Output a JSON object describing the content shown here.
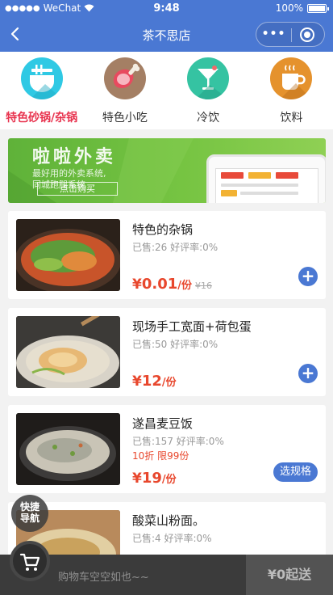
{
  "status_bar": {
    "carrier": "WeChat",
    "time": "9:48",
    "battery": "100%"
  },
  "nav": {
    "title": "茶不思店",
    "more_label": "•••"
  },
  "categories": [
    {
      "label": "特色砂锅/杂锅",
      "icon": "noodle-bowl-icon",
      "active": true
    },
    {
      "label": "特色小吃",
      "icon": "ham-leg-icon",
      "active": false
    },
    {
      "label": "冷饮",
      "icon": "cocktail-icon",
      "active": false
    },
    {
      "label": "饮料",
      "icon": "coffee-cup-icon",
      "active": false
    }
  ],
  "banner": {
    "title": "啦啦外卖",
    "subtitle_1": "最好用的外卖系统,",
    "subtitle_2": "同城跑腿系统",
    "button": "点击购买"
  },
  "products": [
    {
      "name": "特色的杂锅",
      "stats": "已售:26 好评率:0%",
      "discount": "",
      "currency": "¥",
      "price": "0.01",
      "unit": "/份",
      "original_price": "¥16",
      "action": "add"
    },
    {
      "name": "现场手工宽面+荷包蛋",
      "stats": "已售:50 好评率:0%",
      "discount": "",
      "currency": "¥",
      "price": "12",
      "unit": "/份",
      "original_price": "",
      "action": "add"
    },
    {
      "name": "遂昌麦豆饭",
      "stats": "已售:157 好评率:0%",
      "discount": "10折 限99份",
      "currency": "¥",
      "price": "19",
      "unit": "/份",
      "original_price": "",
      "action": "spec",
      "action_label": "选规格"
    },
    {
      "name": "酸菜山粉面。",
      "stats": "已售:4 好评率:0%",
      "discount": "",
      "currency": "",
      "price": "",
      "unit": "",
      "original_price": "",
      "action": "none"
    }
  ],
  "quick_nav": {
    "line1": "快捷",
    "line2": "导航"
  },
  "cart": {
    "empty_text": "购物车空空如也~~",
    "checkout_label": "¥0起送"
  },
  "colors": {
    "brand": "#4a78d3",
    "price": "#e8472d",
    "active": "#e8344f"
  }
}
